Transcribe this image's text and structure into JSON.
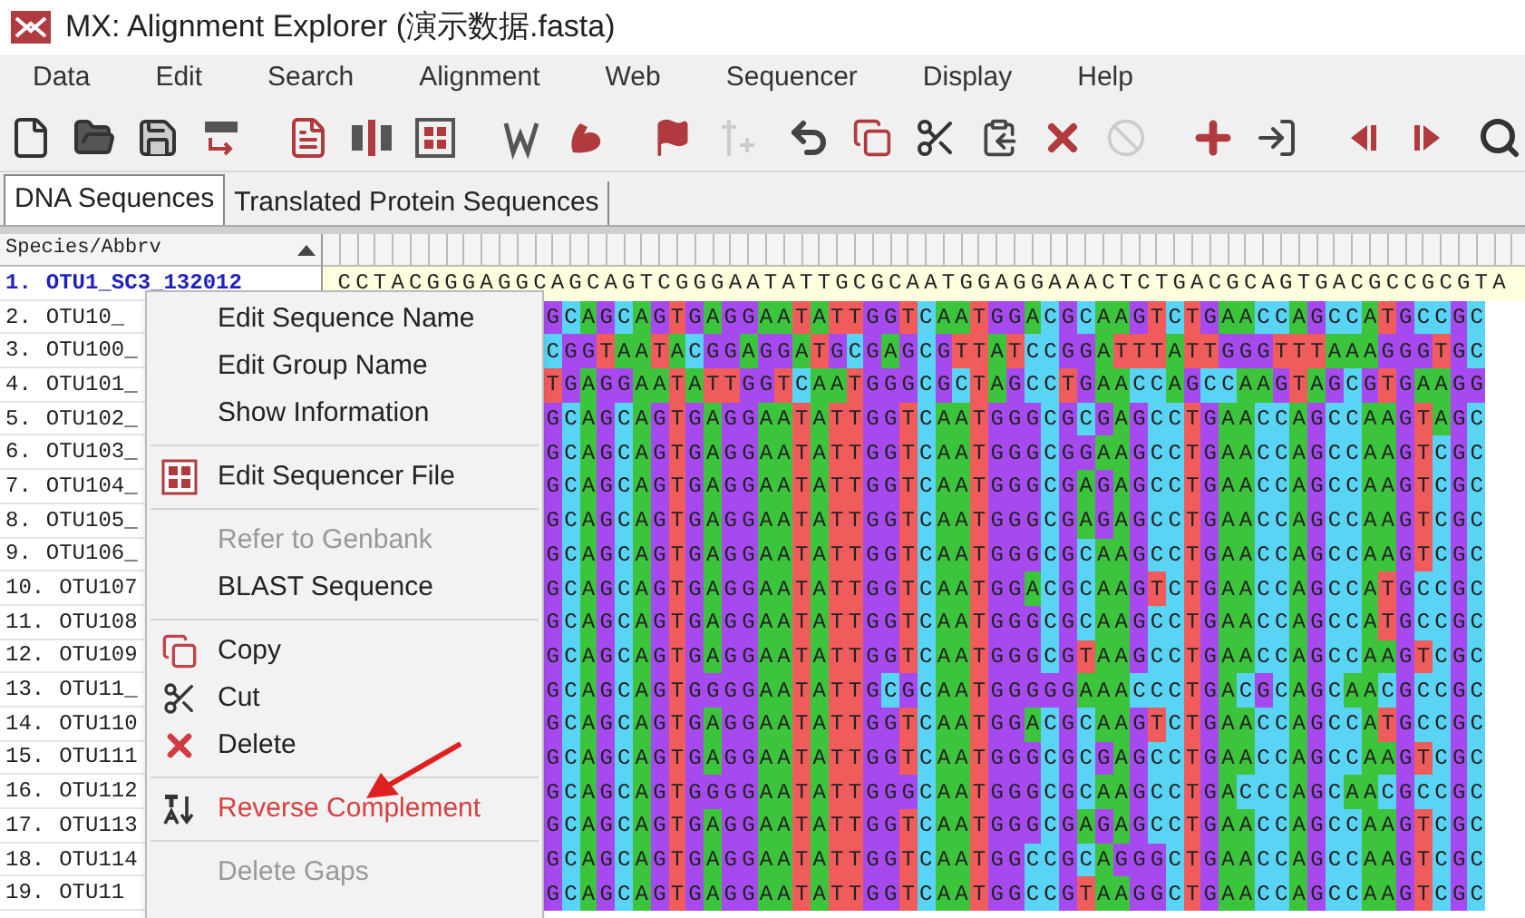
{
  "window": {
    "title": "MX: Alignment Explorer (演示数据.fasta)"
  },
  "menu": [
    "Data",
    "Edit",
    "Search",
    "Alignment",
    "Web",
    "Sequencer",
    "Display",
    "Help"
  ],
  "tabs": [
    {
      "label": "DNA Sequences",
      "selected": true
    },
    {
      "label": "Translated Protein Sequences",
      "selected": false
    }
  ],
  "grid": {
    "header": "Species/Abbrv",
    "rows": [
      {
        "number": "1.",
        "name": "OTU1_SC3_132012",
        "selected": true,
        "sequence": "CCTACGGGAGGCAGCAGTCGGGAATATTGCGCAATGGAGGAAACTCTGACGCAGTGACGCCGCGTA"
      },
      {
        "number": "2.",
        "name": "OTU10_",
        "selected": false,
        "sequence": "GCAGCAGTGAGGAATATTGGTCAATGGACGCAAGTCTGAACCAGCCATGCCGC"
      },
      {
        "number": "3.",
        "name": "OTU100_",
        "selected": false,
        "sequence": "CGGTAATACGGAGGATGCGAGCGTTATCCGGATTTATTGGGTTTAAAGGGTGC"
      },
      {
        "number": "4.",
        "name": "OTU101_",
        "selected": false,
        "sequence": "TGAGGAATATTGGTCAATGGGCGCTAGCCTGAACCAGCCAAGTAGCGTGAAGG"
      },
      {
        "number": "5.",
        "name": "OTU102_",
        "selected": false,
        "sequence": "GCAGCAGTGAGGAATATTGGTCAATGGGCGCGAGCCTGAACCAGCCAAGTAGC"
      },
      {
        "number": "6.",
        "name": "OTU103_",
        "selected": false,
        "sequence": "GCAGCAGTGAGGAATATTGGTCAATGGGCGGAAGCCTGAACCAGCCAAGTCGC"
      },
      {
        "number": "7.",
        "name": "OTU104_",
        "selected": false,
        "sequence": "GCAGCAGTGAGGAATATTGGTCAATGGGCGAGAGCCTGAACCAGCCAAGTCGC"
      },
      {
        "number": "8.",
        "name": "OTU105_",
        "selected": false,
        "sequence": "GCAGCAGTGAGGAATATTGGTCAATGGGCGAGAGCCTGAACCAGCCAAGTCGC"
      },
      {
        "number": "9.",
        "name": "OTU106_",
        "selected": false,
        "sequence": "GCAGCAGTGAGGAATATTGGTCAATGGGCGCAAGCCTGAACCAGCCAAGTCGC"
      },
      {
        "number": "10.",
        "name": "OTU107",
        "selected": false,
        "sequence": "GCAGCAGTGAGGAATATTGGTCAATGGACGCAAGTCTGAACCAGCCATGCCGC"
      },
      {
        "number": "11.",
        "name": "OTU108",
        "selected": false,
        "sequence": "GCAGCAGTGAGGAATATTGGTCAATGGGCGCAAGCCTGAACCAGCCATGCCGC"
      },
      {
        "number": "12.",
        "name": "OTU109",
        "selected": false,
        "sequence": "GCAGCAGTGAGGAATATTGGTCAATGGGCGTAAGCCTGAACCAGCCAAGTCGC"
      },
      {
        "number": "13.",
        "name": "OTU11_",
        "selected": false,
        "sequence": "GCAGCAGTGGGGAATATTGCGCAATGGGGGAAACCCTGACGCAGCAACGCCGC"
      },
      {
        "number": "14.",
        "name": "OTU110",
        "selected": false,
        "sequence": "GCAGCAGTGAGGAATATTGGTCAATGGACGCAAGTCTGAACCAGCCATGCCGC"
      },
      {
        "number": "15.",
        "name": "OTU111",
        "selected": false,
        "sequence": "GCAGCAGTGAGGAATATTGGTCAATGGGCGCGAGCCTGAACCAGCCAAGTCGC"
      },
      {
        "number": "16.",
        "name": "OTU112",
        "selected": false,
        "sequence": "GCAGCAGTGGGGAATATTGGGCAATGGGCGCAAGCCTGACCCAGCAACGCCGC"
      },
      {
        "number": "17.",
        "name": "OTU113",
        "selected": false,
        "sequence": "GCAGCAGTGAGGAATATTGGTCAATGGGCGAGAGCCTGAACCAGCCAAGTCGC"
      },
      {
        "number": "18.",
        "name": "OTU114",
        "selected": false,
        "sequence": "GCAGCAGTGAGGAATATTGGTCAATGGCCGCAGGGCTGAACCAGCCAAGTCGC"
      },
      {
        "number": "19.",
        "name": "OTU11",
        "selected": false,
        "sequence": "GCAGCAGTGAGGAATATTGGTCAATGGCCGTAAGGCTGAACCAGCCAAGTCGC"
      }
    ]
  },
  "context_menu": [
    {
      "kind": "item",
      "label": "Edit Sequence Name",
      "disabled": false,
      "highlighted": false
    },
    {
      "kind": "item",
      "label": "Edit Group Name",
      "disabled": false,
      "highlighted": false
    },
    {
      "kind": "item",
      "label": "Show Information",
      "disabled": false,
      "highlighted": false
    },
    {
      "kind": "separator"
    },
    {
      "kind": "item",
      "label": "Edit Sequencer File",
      "disabled": false,
      "highlighted": false
    },
    {
      "kind": "separator"
    },
    {
      "kind": "item",
      "label": "Refer to Genbank",
      "disabled": true,
      "highlighted": false
    },
    {
      "kind": "item",
      "label": "BLAST Sequence",
      "disabled": false,
      "highlighted": false
    },
    {
      "kind": "separator"
    },
    {
      "kind": "item",
      "label": "Copy",
      "disabled": false,
      "highlighted": false
    },
    {
      "kind": "item",
      "label": "Cut",
      "disabled": false,
      "highlighted": false
    },
    {
      "kind": "item",
      "label": "Delete",
      "disabled": false,
      "highlighted": false
    },
    {
      "kind": "separator"
    },
    {
      "kind": "item",
      "label": "Reverse Complement",
      "disabled": false,
      "highlighted": true
    },
    {
      "kind": "separator"
    },
    {
      "kind": "item",
      "label": "Delete Gaps",
      "disabled": true,
      "highlighted": false
    }
  ]
}
